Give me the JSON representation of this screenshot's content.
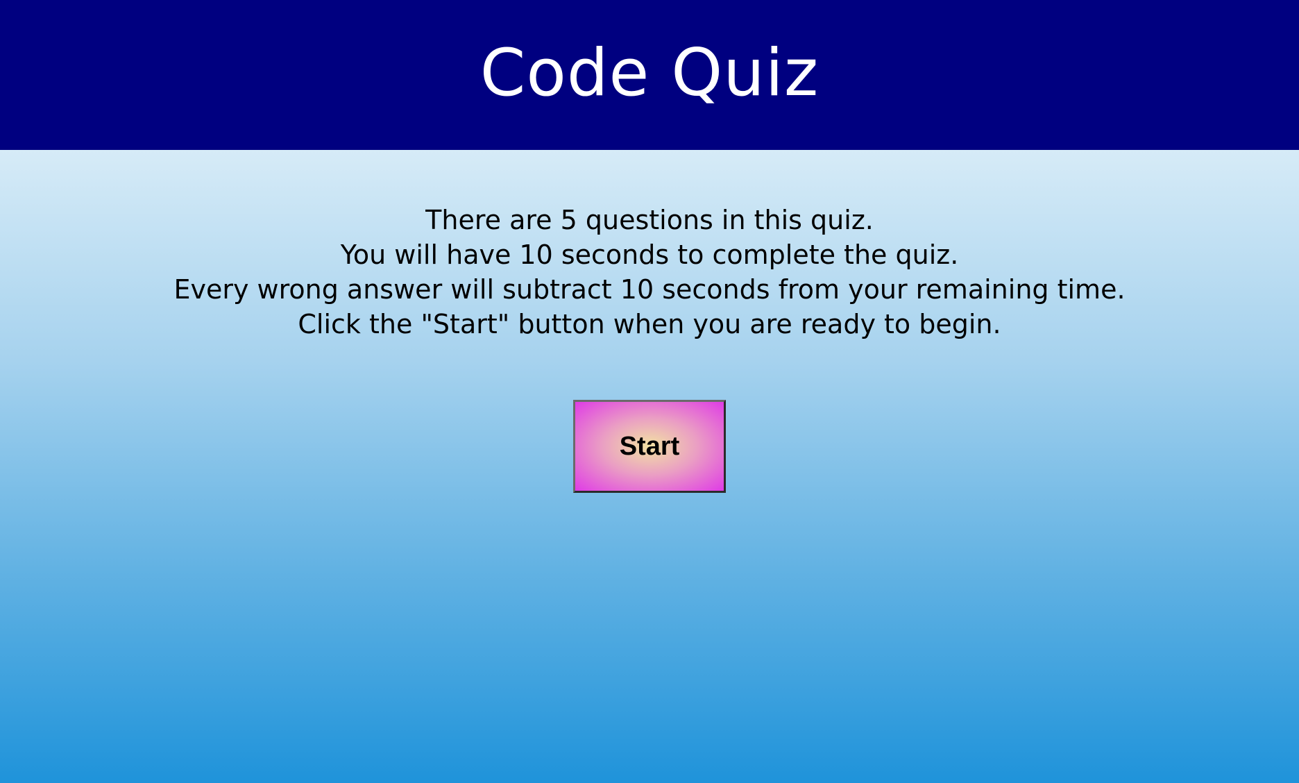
{
  "header": {
    "title": "Code Quiz"
  },
  "instructions": {
    "lines": [
      "There are 5 questions in this quiz.",
      "You will have 10 seconds to complete the quiz.",
      "Every wrong answer will subtract 10 seconds from your remaining time.",
      "Click the \"Start\" button when you are ready to begin."
    ]
  },
  "start_button": {
    "label": "Start"
  },
  "colors": {
    "header_background": "#000080",
    "header_text": "#ffffff",
    "page_gradient_top": "#d6ebf7",
    "page_gradient_bottom": "#1f93da",
    "button_gradient_center": "#f2e2a2",
    "button_gradient_edge": "#df3be6"
  }
}
